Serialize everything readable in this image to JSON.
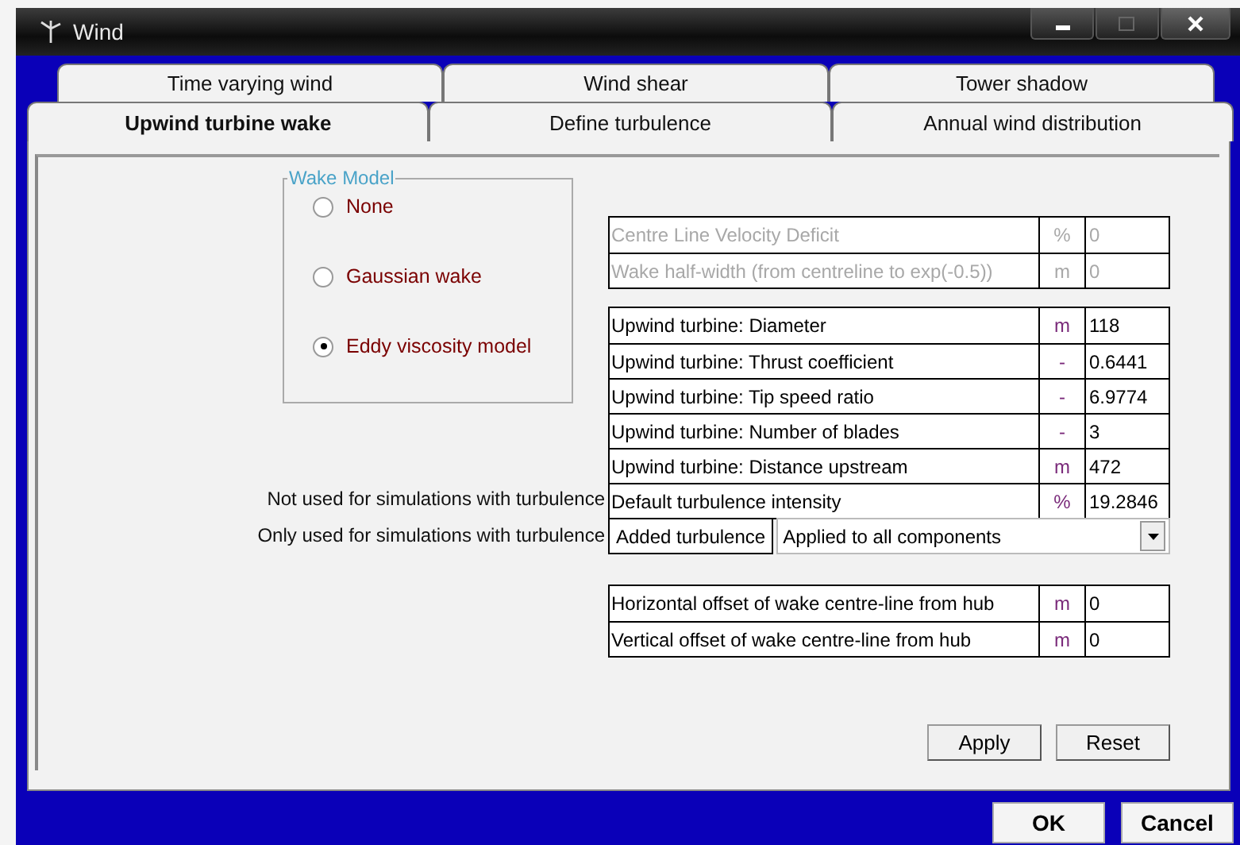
{
  "window": {
    "title": "Wind"
  },
  "tab_rows": [
    [
      {
        "label": "Time varying wind",
        "selected": false
      },
      {
        "label": "Wind shear",
        "selected": false
      },
      {
        "label": "Tower shadow",
        "selected": false
      }
    ],
    [
      {
        "label": "Upwind turbine wake",
        "selected": true
      },
      {
        "label": "Define turbulence",
        "selected": false
      },
      {
        "label": "Annual wind distribution",
        "selected": false
      }
    ]
  ],
  "wake_model": {
    "title": "Wake Model",
    "options": [
      {
        "label": "None",
        "selected": false
      },
      {
        "label": "Gaussian wake",
        "selected": false
      },
      {
        "label": "Eddy viscosity model",
        "selected": true
      }
    ]
  },
  "deficit_table": [
    {
      "label": "Centre Line Velocity Deficit",
      "unit": "%",
      "value": "0",
      "disabled": true
    },
    {
      "label": "Wake half-width (from centreline to exp(-0.5))",
      "unit": "m",
      "value": "0",
      "disabled": true
    }
  ],
  "turbine_table": [
    {
      "label": "Upwind turbine: Diameter",
      "unit": "m",
      "value": "118",
      "disabled": false
    },
    {
      "label": "Upwind turbine: Thrust coefficient",
      "unit": "-",
      "value": "0.6441",
      "disabled": false
    },
    {
      "label": "Upwind turbine: Tip speed ratio",
      "unit": "-",
      "value": "6.9774",
      "disabled": false
    },
    {
      "label": "Upwind turbine: Number of blades",
      "unit": "-",
      "value": "3",
      "disabled": false
    },
    {
      "label": "Upwind turbine: Distance upstream",
      "unit": "m",
      "value": "472",
      "disabled": false
    },
    {
      "label": "Default turbulence intensity",
      "unit": "%",
      "value": "19.2846",
      "disabled": false,
      "note": "Not used for simulations with turbulence"
    }
  ],
  "added_turbulence": {
    "note": "Only used for simulations with turbulence",
    "label": "Added turbulence",
    "dropdown": "Applied to all components"
  },
  "offset_table": [
    {
      "label": "Horizontal offset of wake centre-line from hub",
      "unit": "m",
      "value": "0",
      "disabled": false
    },
    {
      "label": "Vertical offset of wake centre-line from hub",
      "unit": "m",
      "value": "0",
      "disabled": false
    }
  ],
  "panel_buttons": [
    "Apply",
    "Reset"
  ],
  "dialog_buttons": [
    "OK",
    "Cancel"
  ]
}
